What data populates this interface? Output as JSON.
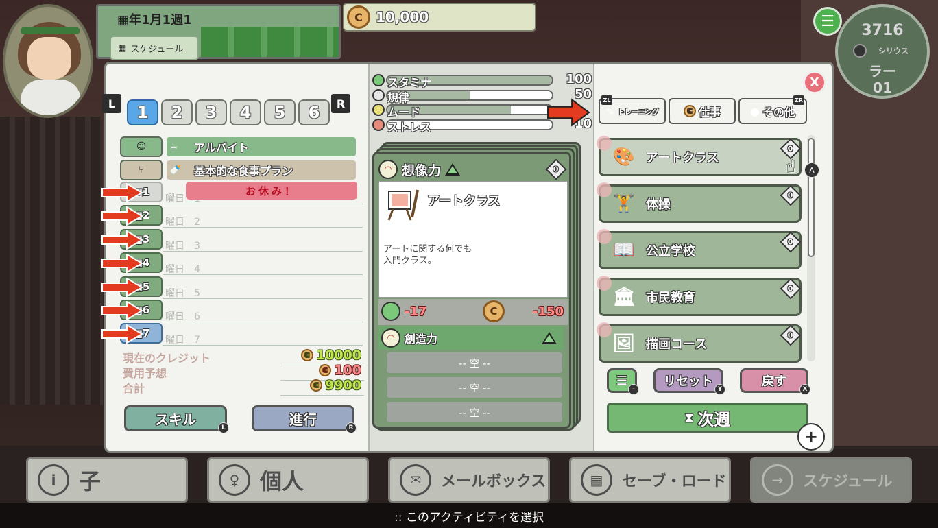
{
  "header": {
    "date": "年1月1週1",
    "schedule_button": "スケジュール",
    "money": "10,000",
    "clock": {
      "number": "3716",
      "name": "シリウス",
      "line1": "ラー",
      "line2": "01"
    }
  },
  "left": {
    "l_tag": "L",
    "r_tag": "R",
    "tabs": [
      "1",
      "2",
      "3",
      "4",
      "5",
      "6"
    ],
    "plans": [
      {
        "label": "アルバイト",
        "color": "#87b98b"
      },
      {
        "label": "基本的な食事プラン",
        "color": "#cdc3ac"
      }
    ],
    "holiday": "お休み！",
    "days": [
      {
        "num": "1",
        "label": "曜日　1"
      },
      {
        "num": "2",
        "label": "曜日　2"
      },
      {
        "num": "3",
        "label": "曜日　3"
      },
      {
        "num": "4",
        "label": "曜日　4"
      },
      {
        "num": "5",
        "label": "曜日　5"
      },
      {
        "num": "6",
        "label": "曜日　6"
      },
      {
        "num": "7",
        "label": "曜日　7"
      }
    ],
    "summary": [
      {
        "label": "現在のクレジット",
        "value": "10000",
        "tone": "g"
      },
      {
        "label": "費用予想",
        "value": "100",
        "tone": "r"
      },
      {
        "label": "合計",
        "value": "9900",
        "tone": "g"
      }
    ],
    "skill_button": "スキル",
    "skill_badge": "L",
    "proceed_button": "進行",
    "proceed_badge": "R"
  },
  "stats": [
    {
      "name": "スタミナ",
      "value": "100",
      "fill": 1.0,
      "color": "#7bc87b"
    },
    {
      "name": "規律",
      "value": "50",
      "fill": 0.5,
      "color": "#e8e8e8"
    },
    {
      "name": "ムード",
      "value": "",
      "fill": 0.75,
      "color": "#e8e07b"
    },
    {
      "name": "ストレス",
      "value": "10",
      "fill": 0.0,
      "color": "#e88a7b"
    }
  ],
  "card": {
    "category": "想像力",
    "tag": "0",
    "title": "アートクラス",
    "description": "アートに関する何でも\n入門クラス。",
    "stamina_cost": "-17",
    "coin_cost": "-150",
    "skill": "創造力",
    "slots": [
      "-- 空 --",
      "-- 空 --",
      "-- 空 --"
    ]
  },
  "right": {
    "close": "X",
    "categories": [
      {
        "label": "トレーニング",
        "key": "ZL",
        "color": "#d5cf4a"
      },
      {
        "label": "仕事",
        "key": "",
        "color": "#9fb698"
      },
      {
        "label": "その他",
        "key": "ZR",
        "color": "#8fb4d8"
      }
    ],
    "activities": [
      {
        "label": "アートクラス",
        "icon": "🎨"
      },
      {
        "label": "体操",
        "icon": "🏋"
      },
      {
        "label": "公立学校",
        "icon": "📖"
      },
      {
        "label": "市民教育",
        "icon": "🏛"
      },
      {
        "label": "描画コース",
        "icon": "🖼"
      }
    ],
    "activity_tag": "0",
    "a_badge": "A",
    "list_button_badge": "-",
    "reset_button": "リセット",
    "reset_badge": "Y",
    "back_button": "戻す",
    "back_badge": "X",
    "next_week_button": "次週",
    "plus": "+"
  },
  "bottom": {
    "buttons": [
      {
        "label": "子",
        "icon": "i",
        "big": true,
        "disabled": false
      },
      {
        "label": "個人",
        "icon": "♀",
        "big": true,
        "disabled": false
      },
      {
        "label": "メールボックス",
        "icon": "✉",
        "big": false,
        "disabled": false
      },
      {
        "label": "セーブ・ロード",
        "icon": "▤",
        "big": false,
        "disabled": false
      },
      {
        "label": "スケジュール",
        "icon": "→",
        "big": false,
        "disabled": true
      }
    ],
    "status": ":: このアクティビティを選択"
  }
}
